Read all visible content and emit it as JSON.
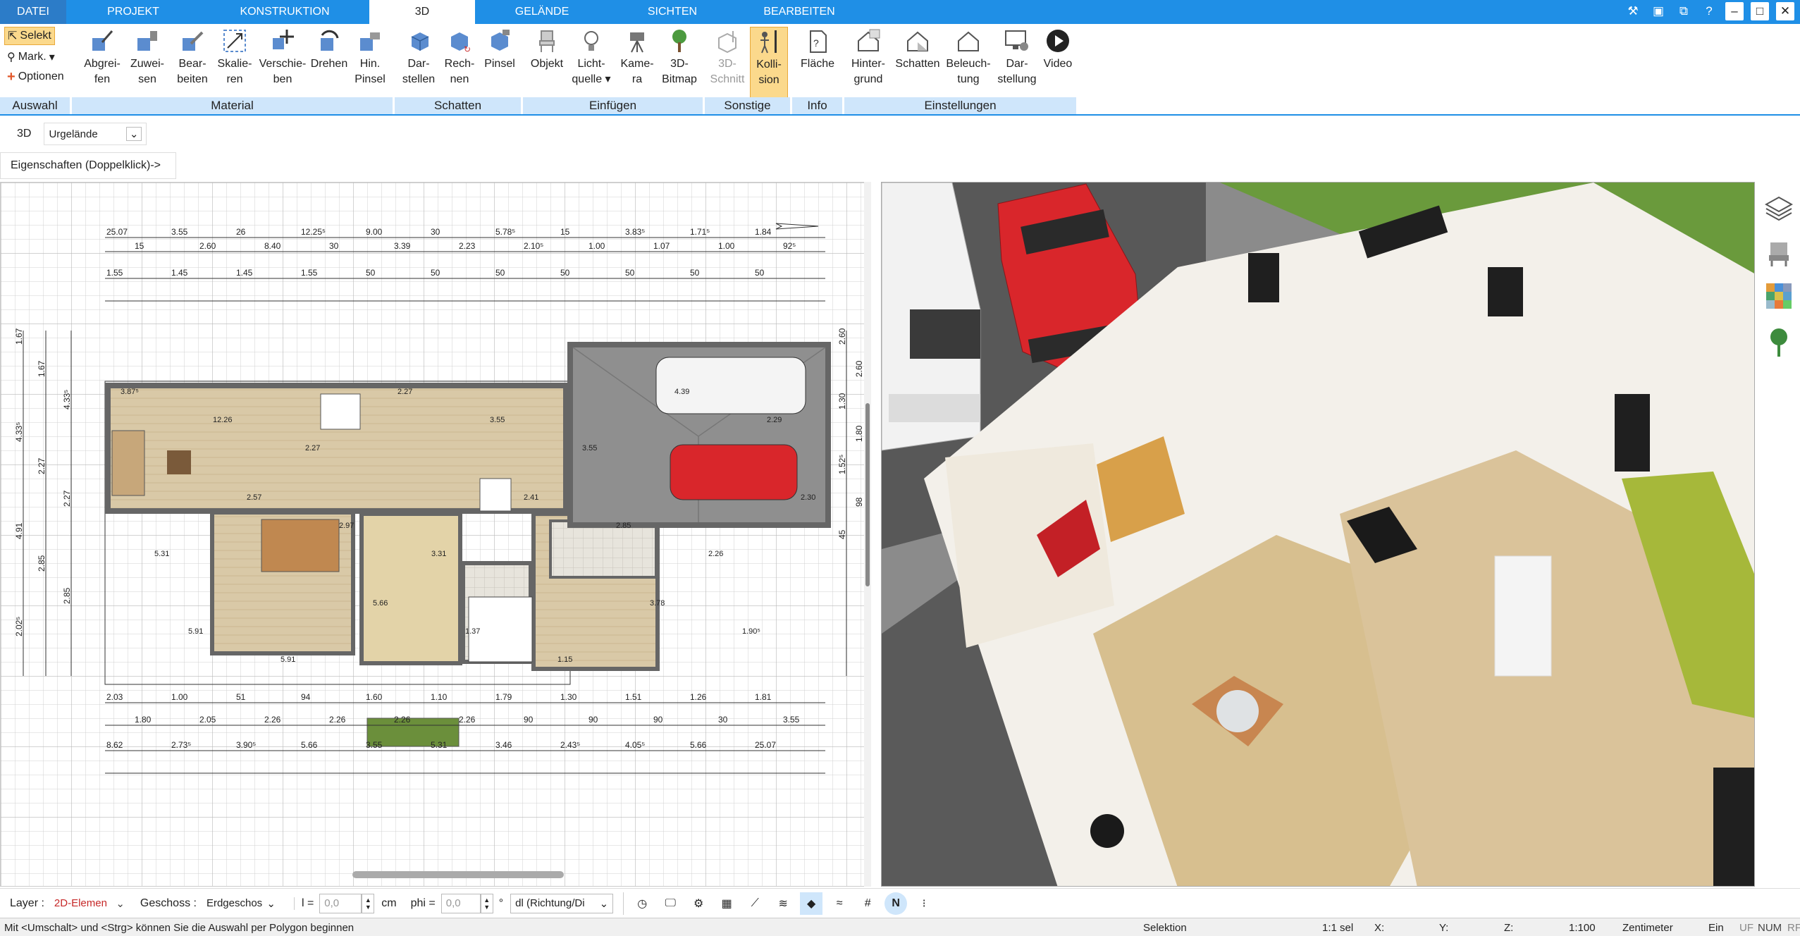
{
  "menu": {
    "tabs": [
      "DATEI",
      "PROJEKT",
      "KONSTRUKTION",
      "3D",
      "GELÄNDE",
      "SICHTEN",
      "BEARBEITEN"
    ],
    "active_tab": "3D"
  },
  "ribbon": {
    "auswahl": {
      "select_label": "Selekt",
      "mark_label": "Mark.",
      "options_label": "Optionen",
      "group_label": "Auswahl"
    },
    "material": {
      "group_label": "Material",
      "buttons": [
        "Abgrei-\nfen",
        "Zuwei-\nsen",
        "Bear-\nbeiten",
        "Skalie-\nren",
        "Verschie-\nben",
        "Drehen",
        "Hin.\nPinsel"
      ]
    },
    "schatten": {
      "group_label": "Schatten",
      "buttons": [
        "Dar-\nstellen",
        "Rech-\nnen",
        "Pinsel"
      ]
    },
    "einfuegen": {
      "group_label": "Einfügen",
      "buttons": [
        "Objekt",
        "Licht-\nquelle ▾",
        "Kame-\nra",
        "3D-\nBitmap"
      ]
    },
    "sonstige": {
      "group_label": "Sonstige",
      "buttons": [
        "3D-\nSchnitt",
        "Kolli-\nsion"
      ]
    },
    "info": {
      "group_label": "Info",
      "buttons": [
        "Fläche"
      ]
    },
    "einstellungen": {
      "group_label": "Einstellungen",
      "buttons": [
        "Hinter-\ngrund",
        "Schatten",
        "Beleuch-\ntung",
        "Dar-\nstellung",
        "Video"
      ]
    }
  },
  "subbar": {
    "mode": "3D",
    "layer_select": "Urgelände"
  },
  "properties_hint": "Eigenschaften (Doppelklick)->",
  "plan": {
    "dims_top": [
      "25.07",
      "3.55",
      "26",
      "12.25⁵",
      "9.00",
      "30",
      "5.78⁵",
      "15",
      "3.83⁵",
      "1.71⁵",
      "1.84",
      "15",
      "2.60",
      "8.40",
      "30",
      "3.39",
      "2.23",
      "2.10⁵",
      "1.00",
      "1.07",
      "1.00",
      "92⁵",
      "1.55",
      "1.45",
      "1.45",
      "1.55",
      "50",
      "50",
      "50",
      "50",
      "50",
      "50",
      "50"
    ],
    "dims_bottom": [
      "2.03",
      "1.00",
      "51",
      "94",
      "1.60",
      "1.10",
      "1.79",
      "1.30",
      "1.51",
      "1.26",
      "1.81",
      "1.80",
      "2.05",
      "2.26",
      "2.26",
      "2.26",
      "2.26",
      "90",
      "90",
      "90",
      "30",
      "3.55",
      "8.62",
      "2.73⁵",
      "3.90⁵",
      "5.66",
      "3.55",
      "5.31",
      "3.46",
      "2.43⁵",
      "4.05⁵",
      "5.66",
      "25.07"
    ],
    "dims_left": [
      "1.67",
      "1.67",
      "4.33⁵",
      "4.33⁵",
      "2.27",
      "2.27",
      "4.91",
      "2.85",
      "2.85",
      "2.02⁵"
    ],
    "dims_right": [
      "2.60",
      "2.60",
      "1.30",
      "1.80",
      "1.52⁵",
      "98",
      "45"
    ],
    "room_labels": [
      "3.87⁵",
      "12.26",
      "2.27",
      "2.27",
      "3.55",
      "3.55",
      "4.39",
      "2.29",
      "5.31",
      "2.57",
      "2.97",
      "3.31",
      "2.41",
      "2.85",
      "2.26",
      "2.30",
      "5.91",
      "5.91",
      "5.66",
      "1.37",
      "1.15",
      "3.78",
      "1.90⁵"
    ]
  },
  "bottom": {
    "layer_label": "Layer :",
    "layer_value": "2D-Elemen",
    "geschoss_label": "Geschoss :",
    "geschoss_value": "Erdgeschos",
    "l_label": "l =",
    "l_value": "0,0",
    "l_unit": "cm",
    "phi_label": "phi =",
    "phi_value": "0,0",
    "phi_unit": "°",
    "direction_value": "dl (Richtung/Di"
  },
  "status": {
    "hint": "Mit <Umschalt> und <Strg> können Sie die Auswahl per Polygon beginnen",
    "mode": "Selektion",
    "sel": "1:1 sel",
    "x": "X:",
    "y": "Y:",
    "z": "Z:",
    "scale": "1:100",
    "unit": "Zentimeter",
    "ein": "Ein",
    "uf": "UF",
    "num": "NUM",
    "rf": "RF"
  },
  "colors": {
    "accent": "#1f8fe6",
    "ribbon_group": "#cfe6fb",
    "selected": "#fbd98c",
    "car_red": "#d9262b",
    "grass": "#6a9a3c"
  },
  "icons": [
    "tools-icon",
    "window-icon",
    "restore-icon",
    "help-icon",
    "minimize-icon",
    "maximize-icon",
    "close-icon",
    "layers-icon",
    "chair-icon",
    "material-icon",
    "tree-icon"
  ]
}
